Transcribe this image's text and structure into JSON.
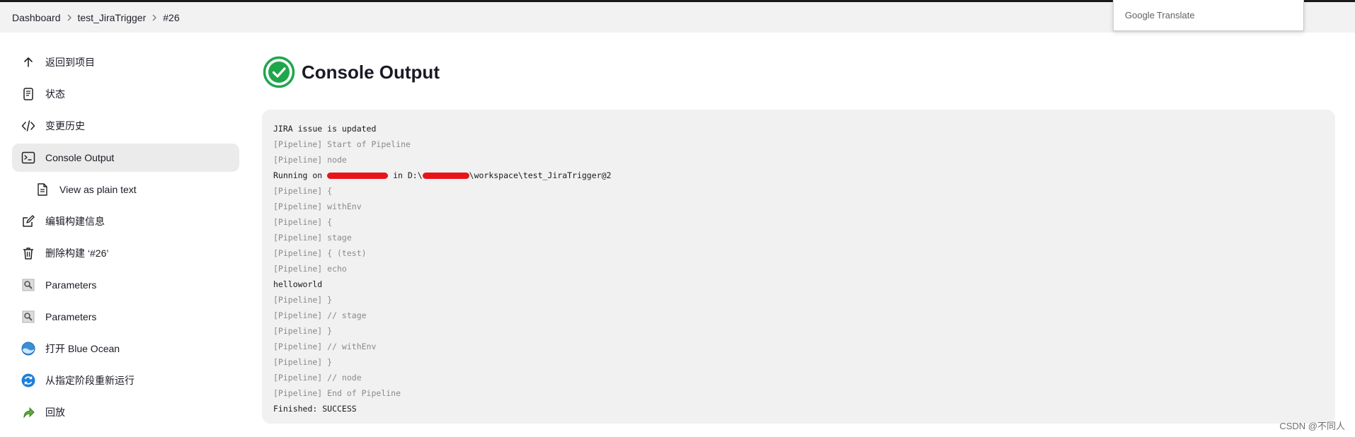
{
  "breadcrumb": {
    "items": [
      "Dashboard",
      "test_JiraTrigger",
      "#26"
    ]
  },
  "google_translate": {
    "google": "Google",
    "translate": "Translate"
  },
  "sidebar": {
    "items": [
      {
        "label": "返回到项目",
        "icon": "arrow-up-icon"
      },
      {
        "label": "状态",
        "icon": "document-icon"
      },
      {
        "label": "变更历史",
        "icon": "code-icon"
      },
      {
        "label": "Console Output",
        "icon": "terminal-icon",
        "active": true
      },
      {
        "label": "View as plain text",
        "icon": "file-text-icon"
      },
      {
        "label": "编辑构建信息",
        "icon": "edit-icon"
      },
      {
        "label": "删除构建 ‘#26’",
        "icon": "trash-icon"
      },
      {
        "label": "Parameters",
        "icon": "parameters-icon"
      },
      {
        "label": "Parameters",
        "icon": "parameters-icon"
      },
      {
        "label": "打开 Blue Ocean",
        "icon": "blue-ocean-icon"
      },
      {
        "label": "从指定阶段重新运行",
        "icon": "restart-icon"
      },
      {
        "label": "回放",
        "icon": "replay-icon"
      }
    ]
  },
  "page": {
    "title": "Console Output",
    "status": "success",
    "status_color": "#1ea64b"
  },
  "console": {
    "lines": [
      {
        "text": "JIRA issue is updated",
        "dim": false
      },
      {
        "text": "[Pipeline] Start of Pipeline",
        "dim": true
      },
      {
        "text": "[Pipeline] node",
        "dim": true
      },
      {
        "text": "Running on ",
        "dim": false,
        "redacted": true,
        "mid": " in D:\\",
        "tail": "\\workspace\\test_JiraTrigger@2"
      },
      {
        "text": "[Pipeline] {",
        "dim": true
      },
      {
        "text": "[Pipeline] withEnv",
        "dim": true
      },
      {
        "text": "[Pipeline] {",
        "dim": true
      },
      {
        "text": "[Pipeline] stage",
        "dim": true
      },
      {
        "text": "[Pipeline] { (test)",
        "dim": true
      },
      {
        "text": "[Pipeline] echo",
        "dim": true
      },
      {
        "text": "helloworld",
        "dim": false
      },
      {
        "text": "[Pipeline] }",
        "dim": true
      },
      {
        "text": "[Pipeline] // stage",
        "dim": true
      },
      {
        "text": "[Pipeline] }",
        "dim": true
      },
      {
        "text": "[Pipeline] // withEnv",
        "dim": true
      },
      {
        "text": "[Pipeline] }",
        "dim": true
      },
      {
        "text": "[Pipeline] // node",
        "dim": true
      },
      {
        "text": "[Pipeline] End of Pipeline",
        "dim": true
      },
      {
        "text": "Finished: SUCCESS",
        "dim": false
      }
    ]
  },
  "watermark": "CSDN @不同人"
}
